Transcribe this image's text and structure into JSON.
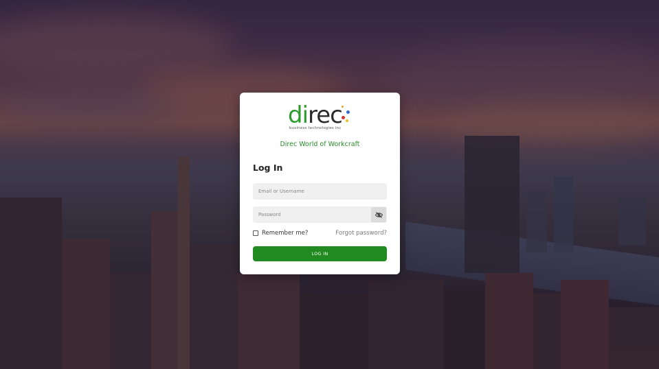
{
  "brand": {
    "logo_main_green": "di",
    "logo_main_dark": "rec",
    "logo_subtitle": "business technologies inc",
    "logo_dot_colors": [
      "#e8a020",
      "#3070d0",
      "#d03030",
      "#e8c020"
    ],
    "tagline": "Direc World of Workcraft",
    "accent_color": "#218a21"
  },
  "login": {
    "heading": "Log In",
    "email_placeholder": "Email or Username",
    "email_value": "",
    "password_placeholder": "Password",
    "password_value": "",
    "password_toggle_icon": "eye-off-icon",
    "remember_label": "Remember me?",
    "remember_checked": false,
    "forgot_label": "Forgot password?",
    "submit_label": "LOG IN"
  }
}
